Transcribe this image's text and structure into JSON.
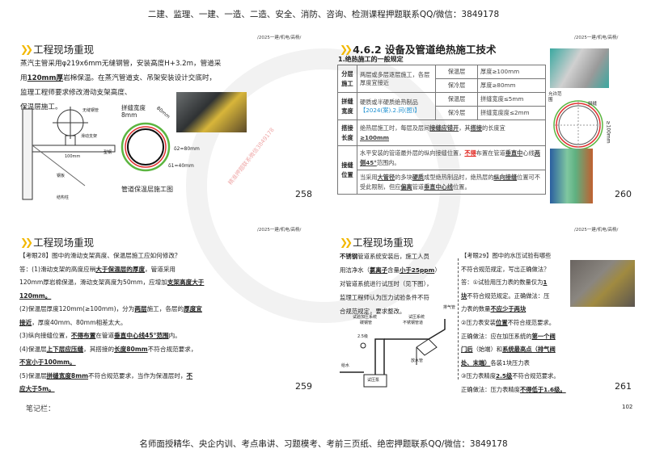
{
  "header": "二建、监理、一建、一造、二造、安全、消防、咨询、检测课程押题联系QQ/微信：3849178",
  "footer": "名师面授精华、央企内训、考点串讲、习题模考、考前三页纸、绝密押题联系QQ/微信：3849178",
  "crumb": "/2025一建/机电/高杨/",
  "watermark": "精准押题联系微信3849178",
  "notes_label": "笔记栏：",
  "sheet_page": "102",
  "slide258": {
    "title": "工程现场重现",
    "text1": "蒸汽主管采用φ219x6mm无缝钢管，安装高度H+3.2m，管道采",
    "text2a": "用",
    "text2b": "120mm厚",
    "text2c": "岩棉保温。在蒸汽管道支、吊架安装设计交底时，",
    "text3": "监理工程师要求修改滑动支架高度、",
    "text4": "保温层施工。",
    "labels": {
      "pipe": "无缝钢管",
      "slide": "滑动支架",
      "beam": "型钢",
      "plate": "钢板",
      "column": "结构柱",
      "dim": "100mm",
      "gap": "拼缝宽度8mm",
      "d80": "80mm",
      "d2": "δ2=80mm",
      "d1": "δ1=40mm",
      "caption": "管道保温层施工图"
    },
    "page": "258"
  },
  "slide260": {
    "title": "4.6.2 设备及管道绝热施工技术",
    "subtitle": "1.绝热施工的一般规定",
    "rows": {
      "r1h": "分层施工",
      "r1t": "两层或多层逐层施工，各层厚度宜接近",
      "r1a": "保温层",
      "r1av": "厚度≥100mm",
      "r1b": "保冷层",
      "r1bv": "厚度≥80mm",
      "r2h": "拼缝宽度",
      "r2t": "硬质或半硬质绝热制品",
      "r2tag": "【2024(案).2.问(图)】",
      "r2a": "保温层",
      "r2av": "拼缝宽度≤5mm",
      "r2b": "保冷层",
      "r2bv": "拼缝宽度度≤2mm",
      "r3h": "搭接长度",
      "r3a": "绝热层施工时，每层及层间",
      "r3b": "接缝应错开",
      "r3c": "，其",
      "r3d": "搭接",
      "r3e": "的长度宜",
      "r3f": "≥100mm",
      "r4h": "接缝位置",
      "r4a": "水平安装的管道最外层的纵向接缝位置，",
      "r4b": "不得",
      "r4c": "布置在管道",
      "r4d": "垂直中",
      "r4e": "心线",
      "r4f": "两侧45°",
      "r4g": "范围内。",
      "r5a": "当采用",
      "r5b": "大管径",
      "r5c": "的多块",
      "r5d": "硬质",
      "r5e": "成型绝热制品时，绝热层的",
      "r5f": "纵向接缝",
      "r5g": "位置可不受此限制，但应",
      "r5h": "偏离",
      "r5i": "管道",
      "r5j": "垂直中心线",
      "r5k": "位置。"
    },
    "fig": {
      "allow": "允许范围",
      "seam": "拼缝",
      "dim": "≥100mm"
    },
    "page": "260"
  },
  "slide259": {
    "title": "工程现场重现",
    "q": "【考眼28】图中的滑动支架高度、保温层施工应如何修改？",
    "a1a": "答：(1)滑动支架的高度应稍",
    "a1b": "大于保温层的厚度",
    "a1c": "，管道采用",
    "a2a": "120mm厚岩棉保温，滑动支架高度为50mm，应增加",
    "a2b": "支架高度大于",
    "a3": "120mm。",
    "b1a": "(2)保温层厚度120mm(≥100mm)，分为",
    "b1b": "两层",
    "b1c": "施工，各层的",
    "b1d": "厚度宜",
    "b2a": "接近",
    "b2b": "，厚度40mm、80mm相差太大。",
    "c1a": "(3)纵向接缝位置，",
    "c1b": "不得布置",
    "c1c": "在管道",
    "c1d": "垂直中心线45°范围",
    "c1e": "内。",
    "d1a": "(4)保温层",
    "d1b": "上下层应压缝",
    "d1c": "，其搭接的",
    "d1d": "长度80mm",
    "d1e": "不符合规范要求，",
    "d2": "不宜小于100mm。",
    "e1a": "(5)保温层",
    "e1b": "拼缝宽度8mm",
    "e1c": "不符合规范要求，当作为保温层时，",
    "e1d": "不",
    "e2": "应大于5m。",
    "page": "259"
  },
  "slide261": {
    "title": "工程现场重现",
    "l1a": "不锈钢",
    "l1b": "管道系统安装后，施工人员",
    "l2a": "用洁净水（",
    "l2b": "氯离子",
    "l2c": "含量",
    "l2d": "小于25ppm",
    "l2e": "）",
    "l3": "对管道系统进行试压时（见下图），",
    "l4": "监理工程师认为压力试验条件不符",
    "l5": "合规范规定，要求整改。",
    "fig": {
      "vent": "排气管",
      "press_sys": "试验加压系统",
      "carbon": "碳钢管",
      "test_sys": "试压系统",
      "ss": "不锈钢管道",
      "grade": "2.5级",
      "drain": "放水管",
      "water": "给水",
      "pump": "试压泵"
    },
    "q1": "【考眼29】图中的水压试验有哪些",
    "q2": "不符合规范规定，写出正确做法？",
    "a1a": "答：①试验用压力表的数量仅为",
    "a1b": "1",
    "a2a": "块",
    "a2b": "不符合规范规定。正确做法：压",
    "a3a": "力表的数量",
    "a3b": "不应少于两块",
    "b1a": "②压力表安装",
    "b1b": "位置",
    "b1c": "不符合规范要求。",
    "b2a": "正确做法：应在加压系统的",
    "b2b": "第一个阀",
    "b3a": "门后",
    "b3b": "（始端）和",
    "b3c": "系统最高点（排气阀",
    "b4a": "处、末端）",
    "b4b": "各装1块压力表",
    "c1a": "③压力表精度",
    "c1b": "2.5级",
    "c1c": "不符合规范要求。",
    "c2a": "正确做法：压力表精度",
    "c2b": "不得低于1.6级。",
    "page": "261"
  }
}
